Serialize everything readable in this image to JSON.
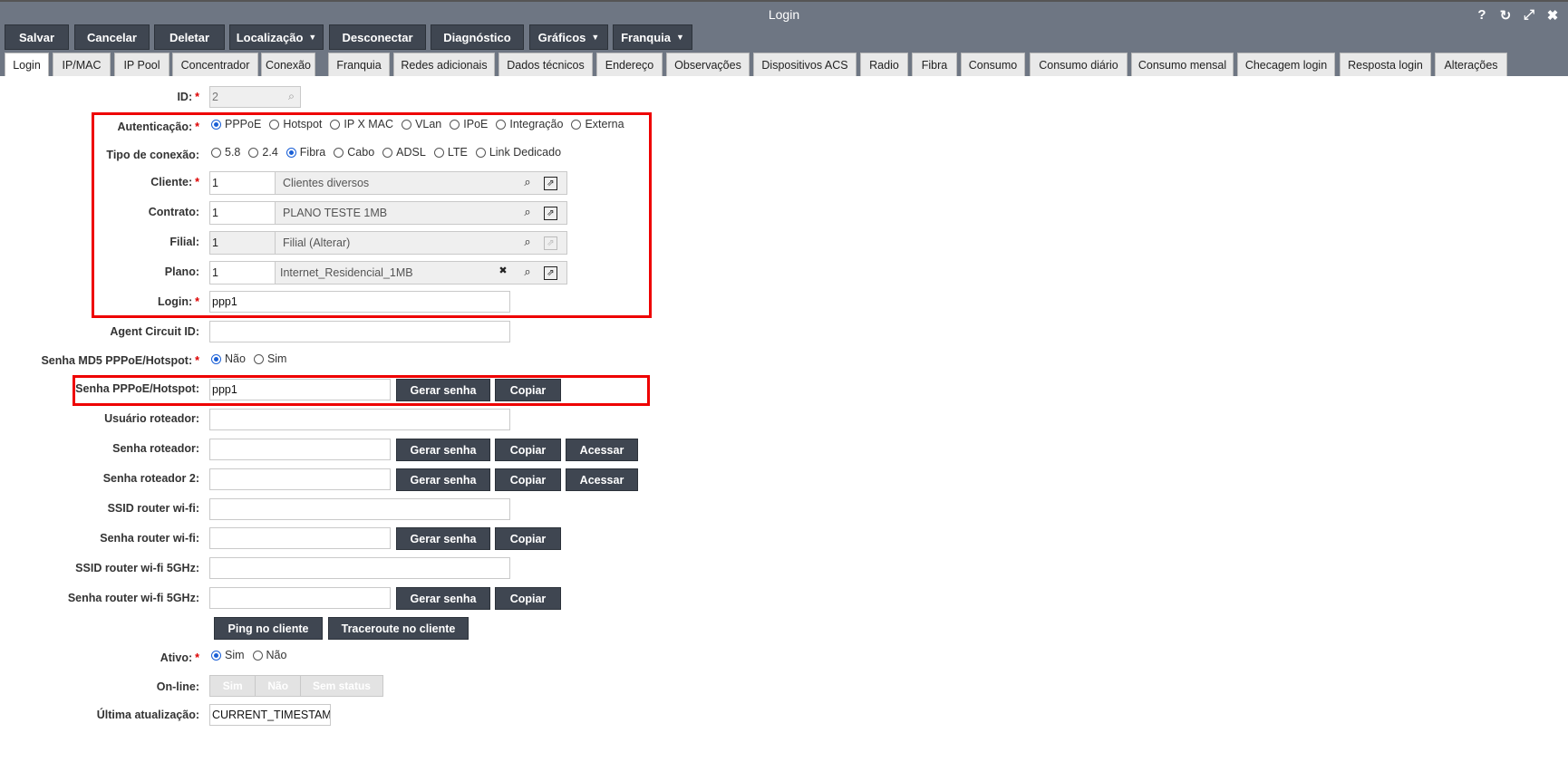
{
  "window": {
    "title": "Login"
  },
  "toolbar": {
    "salvar": "Salvar",
    "cancelar": "Cancelar",
    "deletar": "Deletar",
    "localizacao": "Localização",
    "desconectar": "Desconectar",
    "diagnostico": "Diagnóstico",
    "graficos": "Gráficos",
    "franquia": "Franquia"
  },
  "tabs": [
    "Login",
    "IP/MAC",
    "IP Pool",
    "Concentrador",
    "Conexão",
    "Franquia",
    "Redes adicionais",
    "Dados técnicos",
    "Endereço",
    "Observações",
    "Dispositivos ACS",
    "Radio",
    "Fibra",
    "Consumo",
    "Consumo diário",
    "Consumo mensal",
    "Checagem login",
    "Resposta login",
    "Alterações"
  ],
  "form": {
    "id": {
      "label": "ID:",
      "value": "2"
    },
    "autenticacao": {
      "label": "Autenticação:",
      "options": [
        "PPPoE",
        "Hotspot",
        "IP X MAC",
        "VLan",
        "IPoE",
        "Integração",
        "Externa"
      ],
      "selected": "PPPoE"
    },
    "tipo_conexao": {
      "label": "Tipo de conexão:",
      "options": [
        "5.8",
        "2.4",
        "Fibra",
        "Cabo",
        "ADSL",
        "LTE",
        "Link Dedicado"
      ],
      "selected": "Fibra"
    },
    "cliente": {
      "label": "Cliente:",
      "code": "1",
      "desc": "Clientes diversos"
    },
    "contrato": {
      "label": "Contrato:",
      "code": "1",
      "desc": "PLANO TESTE 1MB"
    },
    "filial": {
      "label": "Filial:",
      "code": "1",
      "desc": "Filial (Alterar)"
    },
    "plano": {
      "label": "Plano:",
      "code": "1",
      "desc": "Internet_Residencial_1MB"
    },
    "login": {
      "label": "Login:",
      "value": "ppp1"
    },
    "agent_circuit_id": {
      "label": "Agent Circuit ID:",
      "value": ""
    },
    "senha_md5": {
      "label": "Senha MD5 PPPoE/Hotspot:",
      "options": [
        "Não",
        "Sim"
      ],
      "selected": "Não"
    },
    "senha_pppoe": {
      "label": "Senha PPPoE/Hotspot:",
      "value": "ppp1"
    },
    "usuario_roteador": {
      "label": "Usuário roteador:",
      "value": ""
    },
    "senha_roteador": {
      "label": "Senha roteador:",
      "value": ""
    },
    "senha_roteador2": {
      "label": "Senha roteador 2:",
      "value": ""
    },
    "ssid_wifi": {
      "label": "SSID router wi-fi:",
      "value": ""
    },
    "senha_wifi": {
      "label": "Senha router wi-fi:",
      "value": ""
    },
    "ssid_wifi5": {
      "label": "SSID router wi-fi 5GHz:",
      "value": ""
    },
    "senha_wifi5": {
      "label": "Senha router wi-fi 5GHz:",
      "value": ""
    },
    "ativo": {
      "label": "Ativo:",
      "options": [
        "Sim",
        "Não"
      ],
      "selected": "Sim"
    },
    "online": {
      "label": "On-line:",
      "options": [
        "Sim",
        "Não",
        "Sem status"
      ]
    },
    "ultima_atualizacao": {
      "label": "Última atualização:",
      "value": "CURRENT_TIMESTAMP"
    }
  },
  "buttons": {
    "gerar_senha": "Gerar senha",
    "copiar": "Copiar",
    "acessar": "Acessar",
    "ping": "Ping no cliente",
    "traceroute": "Traceroute no cliente"
  },
  "icons": {
    "help": "?",
    "history": "↻",
    "expand": "⤢",
    "close": "✖",
    "search": "⌕",
    "open": "⇗",
    "clear": "✖"
  },
  "colors": {
    "header": "#6e7683",
    "button": "#3f4651",
    "highlight": "#e00000",
    "radio": "#1a5fd6"
  }
}
